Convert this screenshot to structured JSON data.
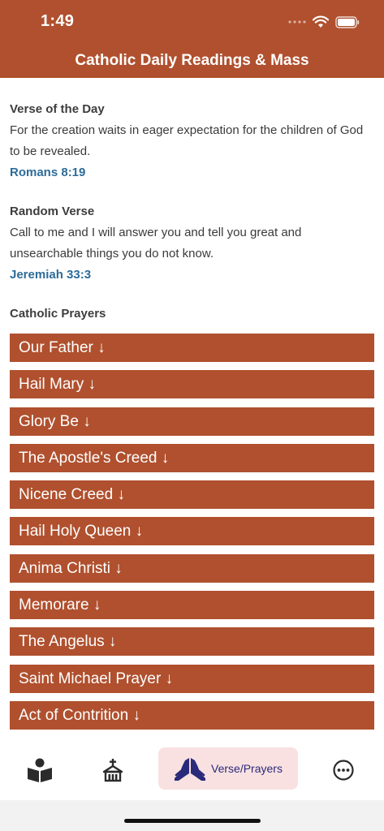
{
  "status_bar": {
    "time": "1:49"
  },
  "header": {
    "title": "Catholic Daily Readings & Mass"
  },
  "verse_of_the_day": {
    "heading": "Verse of the Day",
    "text": "For the creation waits in eager expectation for the children of God to be revealed.",
    "reference": "Romans 8:19"
  },
  "random_verse": {
    "heading": "Random Verse",
    "text": "Call to me and I will answer you and tell you great and unsearchable things you do not know.",
    "reference": "Jeremiah 33:3"
  },
  "prayers": {
    "heading": "Catholic Prayers",
    "items": [
      "Our Father ↓",
      "Hail Mary ↓",
      "Glory Be ↓",
      "The Apostle's Creed ↓",
      "Nicene Creed ↓",
      "Hail Holy Queen ↓",
      "Anima Christi ↓",
      "Memorare ↓",
      "The Angelus ↓",
      "Saint Michael Prayer ↓",
      "Act of Contrition ↓"
    ]
  },
  "tab_bar": {
    "active_label": "Verse/Prayers",
    "tabs": [
      "book-reader-icon",
      "church-icon",
      "praying-hands-icon",
      "more-icon"
    ]
  },
  "colors": {
    "brand": "#b0502e",
    "link": "#2d6c99",
    "active_tab_bg": "#f9e1e2",
    "active_tab_icon": "#2a2a7a"
  }
}
